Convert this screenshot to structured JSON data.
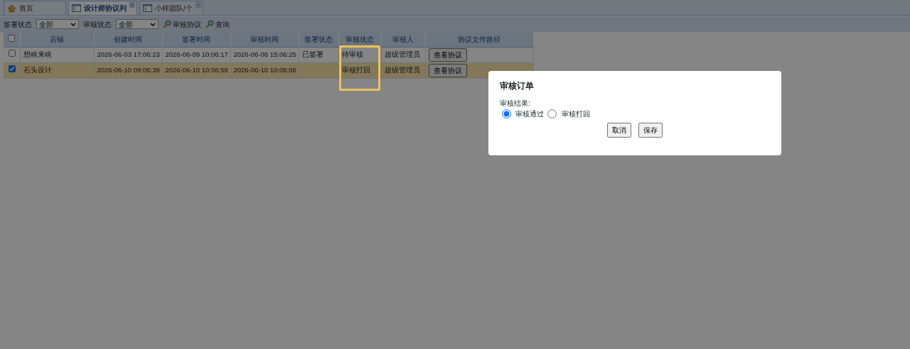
{
  "tabs": [
    {
      "label": "首页",
      "kind": "home",
      "selected": false,
      "closable": false
    },
    {
      "label": "设计师协议列",
      "kind": "list",
      "selected": true,
      "closable": true
    },
    {
      "label": "小样团队/个",
      "kind": "list",
      "selected": false,
      "closable": true
    }
  ],
  "filters": [
    {
      "label": "签署状态",
      "value": "全部"
    },
    {
      "label": "审核状态",
      "value": "全部"
    }
  ],
  "toolbar_buttons": [
    "审核协议",
    "查询"
  ],
  "table": {
    "all_checked": false,
    "columns": [
      {
        "label": "店铺",
        "highlighted": false
      },
      {
        "label": "创建时间",
        "highlighted": false
      },
      {
        "label": "签署时间",
        "highlighted": false
      },
      {
        "label": "审核时间",
        "highlighted": false
      },
      {
        "label": "签署状态",
        "highlighted": false
      },
      {
        "label": "审核状态",
        "highlighted": true
      },
      {
        "label": "审核人",
        "highlighted": false
      },
      {
        "label": "协议文件路径",
        "highlighted": false
      }
    ],
    "rows": [
      {
        "selected": false,
        "checked": false,
        "cells": [
          "想啥来啥",
          "2026-06-03 17:06:23",
          "2026-06-09 10:06:17",
          "2026-06-06 15:06:25",
          "已签署",
          "待审核",
          "超级管理员"
        ],
        "action": "查看协议"
      },
      {
        "selected": true,
        "checked": true,
        "cells": [
          "石头设计",
          "2026-06-10 09:06:39",
          "2026-06-10 10:06:58",
          "2026-06-10 10:06:06",
          "",
          "审核打回",
          "超级管理员"
        ],
        "action": "查看协议"
      }
    ]
  },
  "dialog": {
    "title": "审核订单",
    "field_label": "审核结果:",
    "options": [
      {
        "label": "审核通过",
        "selected": true
      },
      {
        "label": "审核打回",
        "selected": false
      }
    ],
    "buttons": [
      "取消",
      "保存"
    ]
  }
}
